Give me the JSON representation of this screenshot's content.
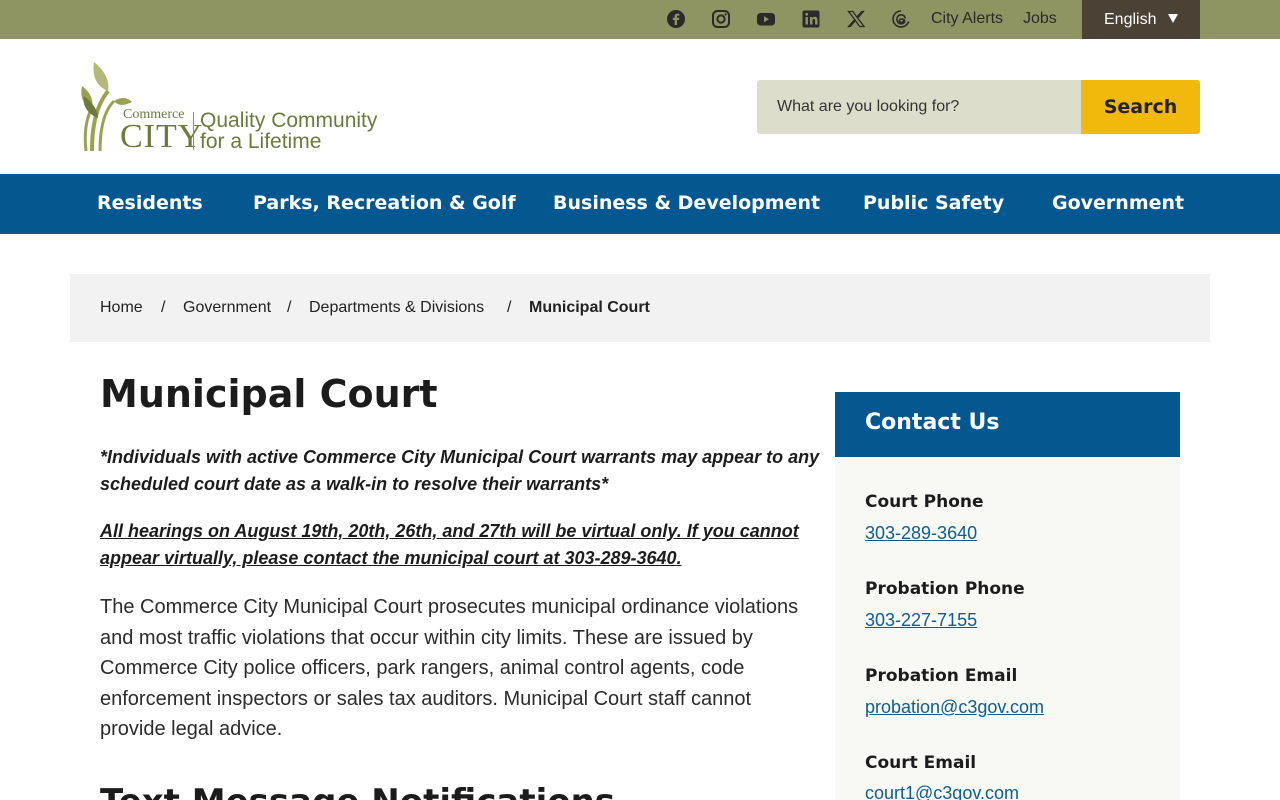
{
  "topbar": {
    "social": [
      {
        "icon": "facebook-icon"
      },
      {
        "icon": "instagram-icon"
      },
      {
        "icon": "youtube-icon"
      },
      {
        "icon": "linkedin-icon"
      },
      {
        "icon": "x-icon"
      },
      {
        "icon": "threads-icon"
      }
    ],
    "city_alerts": "City Alerts",
    "jobs": "Jobs",
    "language": "English"
  },
  "header": {
    "logo": {
      "name_top": "Commerce",
      "name_bottom": "CITY",
      "tagline_line1": "Quality Community",
      "tagline_line2": "for a Lifetime"
    },
    "search": {
      "placeholder": "What are you looking for?",
      "button_label": "Search"
    }
  },
  "nav": {
    "items": [
      {
        "label": "Residents"
      },
      {
        "label": "Parks, Recreation & Golf"
      },
      {
        "label": "Business & Development"
      },
      {
        "label": "Public Safety"
      },
      {
        "label": "Government"
      }
    ]
  },
  "breadcrumb": {
    "items": [
      {
        "label": "Home"
      },
      {
        "label": "Government"
      },
      {
        "label": "Departments & Divisions"
      },
      {
        "label": "Municipal Court"
      }
    ],
    "separator": "/"
  },
  "main": {
    "title": "Municipal Court",
    "notice_warrants": "*Individuals with active Commerce City Municipal Court warrants may appear to any scheduled court date as a walk-in to resolve their warrants*",
    "notice_virtual": "All hearings on August 19th, 20th, 26th, and 27th will be virtual only. If you cannot appear virtually, please contact the municipal court at 303-289-3640.",
    "description": "The Commerce City Municipal Court prosecutes municipal ordinance violations and most traffic violations that occur within city limits. These are issued by Commerce City police officers, park rangers, animal control agents, code enforcement inspectors or sales tax auditors. Municipal Court staff cannot provide legal advice.",
    "next_section_title": "Text Message Notifications"
  },
  "contact": {
    "title": "Contact Us",
    "entries": [
      {
        "label": "Court Phone",
        "value": "303-289-3640"
      },
      {
        "label": "Probation Phone",
        "value": "303-227-7155"
      },
      {
        "label": "Probation Email",
        "value": "probation@c3gov.com"
      },
      {
        "label": "Court Email",
        "value": "court1@c3gov.com"
      }
    ]
  },
  "colors": {
    "topbar": "#8f9562",
    "nav": "#04578f",
    "search_button": "#f0b90b",
    "link": "#0d5c94"
  }
}
